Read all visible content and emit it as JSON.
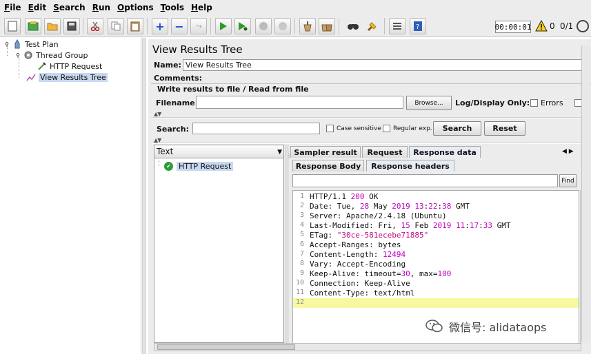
{
  "menu": [
    {
      "label": "File"
    },
    {
      "label": "Edit"
    },
    {
      "label": "Search"
    },
    {
      "label": "Run"
    },
    {
      "label": "Options"
    },
    {
      "label": "Tools"
    },
    {
      "label": "Help"
    }
  ],
  "toolbar": {
    "timer": "00:00:01",
    "warning_count": "0",
    "threads": "0/1",
    "icons": [
      "new-icon",
      "templates-icon",
      "open-icon",
      "save-icon",
      "cut-icon",
      "copy-icon",
      "paste-icon",
      "expand-icon",
      "collapse-icon",
      "toggle-icon",
      "start-icon",
      "start-no-pause-icon",
      "stop-icon",
      "shutdown-icon",
      "clear-icon",
      "clear-all-icon",
      "search-icon",
      "reset-search-icon",
      "function-helper-icon",
      "help-icon",
      "warning-icon",
      "remote-icon"
    ]
  },
  "tree": {
    "items": [
      {
        "label": "Test Plan",
        "icon": "test-plan-icon"
      },
      {
        "label": "Thread Group",
        "icon": "gear-icon"
      },
      {
        "label": "HTTP Request",
        "icon": "pipette-icon"
      },
      {
        "label": "View Results Tree",
        "icon": "chart-icon"
      }
    ]
  },
  "panel": {
    "title": "View Results Tree",
    "name_label": "Name:",
    "name_value": "View Results Tree",
    "comments_label": "Comments:",
    "write_title": "Write results to file / Read from file",
    "filename_label": "Filename",
    "browse_label": "Browse...",
    "log_display_label": "Log/Display Only:",
    "errors_label": "Errors",
    "search_label": "Search:",
    "case_sensitive_label": "Case sensitive",
    "regex_label": "Regular exp.",
    "search_button": "Search",
    "reset_button": "Reset"
  },
  "results": {
    "renderer": "Text",
    "items": [
      {
        "label": "HTTP Request",
        "status": "success"
      }
    ]
  },
  "tabs": {
    "primary": [
      "Sampler result",
      "Request",
      "Response data"
    ],
    "primary_active": "Response data",
    "secondary": [
      "Response Body",
      "Response headers"
    ],
    "secondary_active": "Response headers",
    "find_button": "Find"
  },
  "response_headers": [
    {
      "n": "1",
      "text": "HTTP/1.1 200 OK"
    },
    {
      "n": "2",
      "text": "Date: Tue, 28 May 2019 13:22:38 GMT"
    },
    {
      "n": "3",
      "text": "Server: Apache/2.4.18 (Ubuntu)"
    },
    {
      "n": "4",
      "text": "Last-Modified: Fri, 15 Feb 2019 11:17:33 GMT"
    },
    {
      "n": "5",
      "text": "ETag: \"30ce-581ecebe71885\""
    },
    {
      "n": "6",
      "text": "Accept-Ranges: bytes"
    },
    {
      "n": "7",
      "text": "Content-Length: 12494"
    },
    {
      "n": "8",
      "text": "Vary: Accept-Encoding"
    },
    {
      "n": "9",
      "text": "Keep-Alive: timeout=30, max=100"
    },
    {
      "n": "10",
      "text": "Connection: Keep-Alive"
    },
    {
      "n": "11",
      "text": "Content-Type: text/html"
    },
    {
      "n": "12",
      "text": ""
    }
  ],
  "watermark": "微信号: alidataops"
}
